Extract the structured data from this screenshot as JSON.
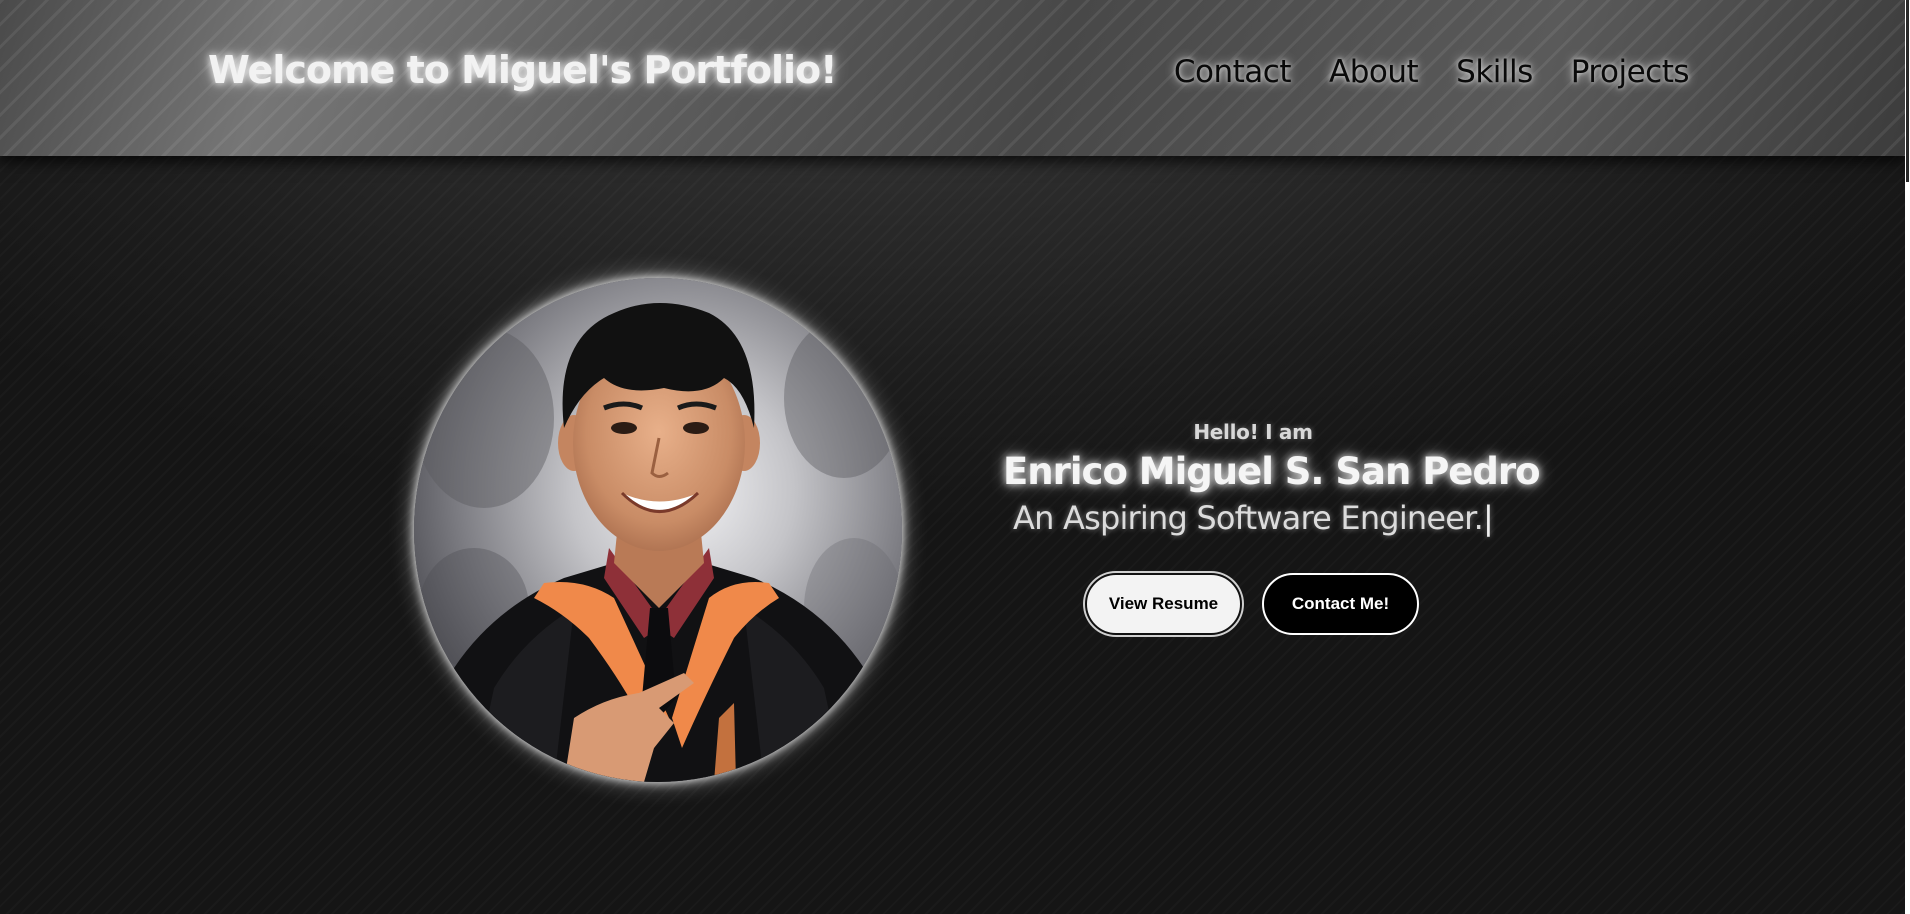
{
  "header": {
    "title": "Welcome to Miguel's Portfolio!",
    "nav": [
      {
        "label": "Contact"
      },
      {
        "label": "About"
      },
      {
        "label": "Skills"
      },
      {
        "label": "Projects"
      }
    ]
  },
  "hero": {
    "greeting": "Hello! I am",
    "name": "Enrico Miguel S. San Pedro",
    "tagline": "An Aspiring Software Engineer.",
    "cursor": "|",
    "buttons": {
      "resume": "View Resume",
      "contact": "Contact Me!"
    },
    "photo": "profile-photo"
  },
  "colors": {
    "header_bg": "#5c5c5c",
    "page_bg": "#1a1a1a",
    "accent_orange": "#f0894a",
    "button_light": "#f3f3f3",
    "button_dark": "#000000"
  }
}
